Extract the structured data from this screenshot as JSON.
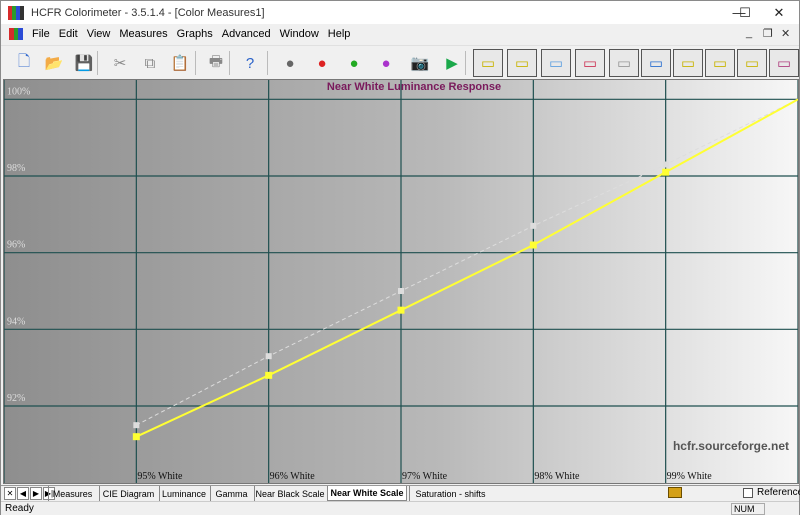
{
  "window": {
    "title": "HCFR Colorimeter - 3.5.1.4 - [Color Measures1]",
    "controls": {
      "minimize": "—",
      "maximize": "☐",
      "close": "✕"
    }
  },
  "menu": {
    "items": [
      "File",
      "Edit",
      "View",
      "Measures",
      "Graphs",
      "Advanced",
      "Window",
      "Help"
    ],
    "mdi": {
      "minimize": "_",
      "restore": "❐",
      "close": "✕"
    }
  },
  "toolbar": {
    "buttons": [
      "new-document",
      "open-folder",
      "save",
      "cut",
      "copy",
      "paste",
      "print",
      "help",
      "measure-gray",
      "measure-primaries",
      "measure-secondaries",
      "measure-all",
      "camera",
      "play",
      "graph-gray-luminance",
      "graph-gamma",
      "graph-rgb-levels",
      "graph-rgb-histogram",
      "graph-color-temp",
      "graph-cie",
      "graph-near-black",
      "graph-near-white",
      "graph-saturation",
      "graph-measures"
    ]
  },
  "tabs": {
    "items": [
      "Measures",
      "CIE Diagram",
      "Luminance",
      "Gamma",
      "Near Black Scale",
      "Near White Scale",
      "Saturation - shifts"
    ],
    "active_index": 5,
    "nav": [
      "✕",
      "◀",
      "▶",
      "▶|"
    ]
  },
  "reference": {
    "label": "Reference",
    "checked": false
  },
  "status": {
    "text": "Ready",
    "num": "NUM"
  },
  "colors": {
    "title": "#7a1a5c",
    "grid": "#1e4f4f",
    "series_measured": "#ffff33",
    "series_reference": "#dddddd",
    "site_text": "#555555"
  },
  "chart_data": {
    "type": "line",
    "title": "Near White Luminance Response",
    "watermark": "hcfr.sourceforge.net",
    "categories": [
      "95% White",
      "96% White",
      "97% White",
      "98% White",
      "99% White"
    ],
    "x_range": [
      94,
      100
    ],
    "y_ticks": [
      "92%",
      "94%",
      "96%",
      "98%",
      "100%"
    ],
    "ylim": [
      90.2,
      100.4
    ],
    "grid": true,
    "series": [
      {
        "name": "",
        "role": "reference",
        "style": "dashed",
        "x": [
          95,
          96,
          97,
          98,
          99,
          100
        ],
        "y": [
          91.5,
          93.3,
          95.0,
          96.7,
          98.3,
          100.0
        ]
      },
      {
        "name": "",
        "role": "measured",
        "style": "solid",
        "x": [
          95,
          96,
          97,
          98,
          99,
          100
        ],
        "y": [
          91.2,
          92.8,
          94.5,
          96.2,
          98.1,
          100.0
        ]
      }
    ]
  }
}
